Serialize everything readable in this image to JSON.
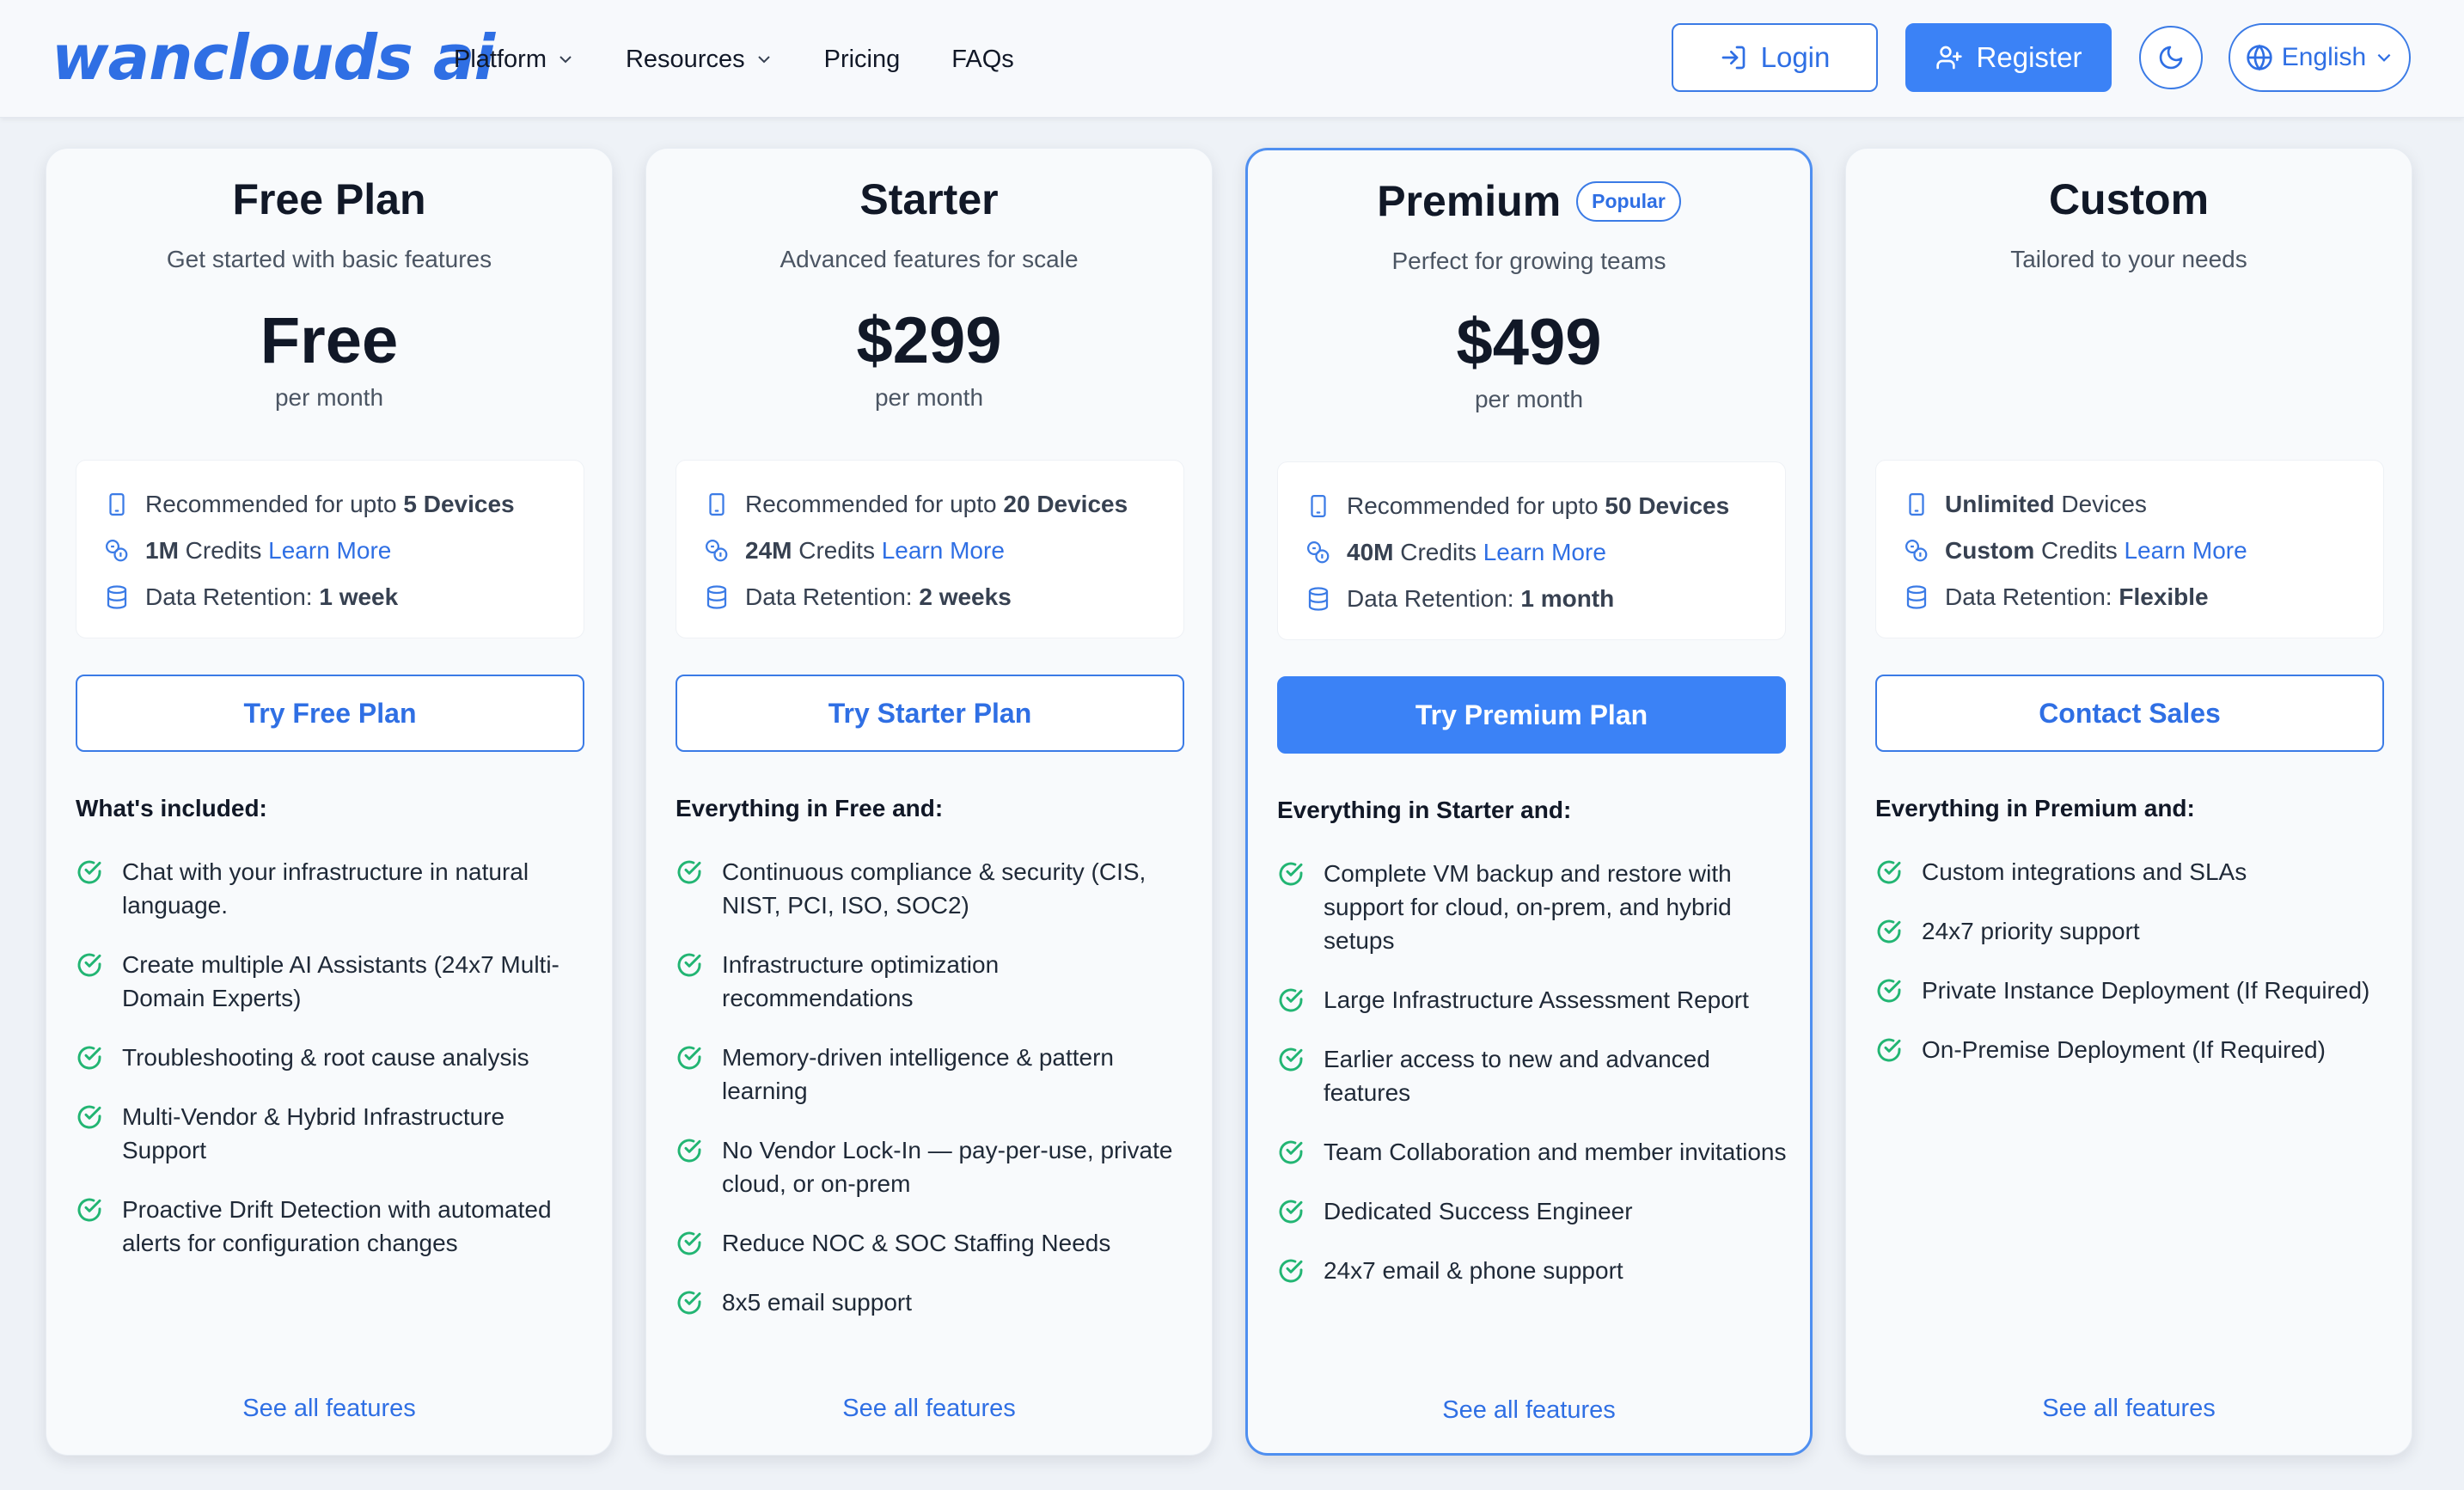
{
  "header": {
    "logo": "wanclouds ai",
    "nav": [
      "Platform",
      "Resources",
      "Pricing",
      "FAQs"
    ],
    "login_label": "Login",
    "register_label": "Register",
    "language_label": "English",
    "accent_color": "#3b82f6"
  },
  "plans": [
    {
      "title": "Free Plan",
      "badge": "",
      "subtitle": "Get started with basic features",
      "price": "Free",
      "period": "per month",
      "devices_prefix": "Recommended for upto ",
      "devices_value": "5 Devices",
      "devices_suffix": "",
      "credits_value": "1M",
      "credits_text": " Credits ",
      "learn_more": "Learn More",
      "retention_label": "Data Retention: ",
      "retention_value": "1 week",
      "cta": "Try Free Plan",
      "included_heading": "What's included:",
      "features": [
        "Chat with your infrastructure in natural language.",
        "Create multiple AI Assistants (24x7 Multi-Domain Experts)",
        "Troubleshooting & root cause analysis",
        "Multi-Vendor & Hybrid Infrastructure Support",
        "Proactive Drift Detection with automated alerts for configuration changes"
      ],
      "see_all": "See all features"
    },
    {
      "title": "Starter",
      "badge": "",
      "subtitle": "Advanced features for scale",
      "price": "$299",
      "period": "per month",
      "devices_prefix": "Recommended for upto ",
      "devices_value": "20 Devices",
      "devices_suffix": "",
      "credits_value": "24M",
      "credits_text": " Credits ",
      "learn_more": "Learn More",
      "retention_label": "Data Retention: ",
      "retention_value": "2 weeks",
      "cta": "Try Starter Plan",
      "included_heading": "Everything in Free and:",
      "features": [
        "Continuous compliance & security (CIS, NIST, PCI, ISO, SOC2)",
        "Infrastructure optimization recommendations",
        "Memory-driven intelligence & pattern learning",
        "No Vendor Lock-In — pay-per-use, private cloud, or on-prem",
        "Reduce NOC & SOC Staffing Needs",
        "8x5 email support"
      ],
      "see_all": "See all features"
    },
    {
      "title": "Premium",
      "badge": "Popular",
      "subtitle": "Perfect for growing teams",
      "price": "$499",
      "period": "per month",
      "devices_prefix": "Recommended for upto ",
      "devices_value": "50 Devices",
      "devices_suffix": "",
      "credits_value": "40M",
      "credits_text": " Credits ",
      "learn_more": "Learn More",
      "retention_label": "Data Retention: ",
      "retention_value": "1 month",
      "cta": "Try Premium Plan",
      "included_heading": "Everything in Starter and:",
      "features": [
        "Complete VM backup and restore with support for cloud, on-prem, and hybrid setups",
        "Large Infrastructure Assessment Report",
        "Earlier access to new and advanced features",
        "Team Collaboration and member invitations",
        "Dedicated Success Engineer",
        "24x7 email & phone support"
      ],
      "see_all": "See all features"
    },
    {
      "title": "Custom",
      "badge": "",
      "subtitle": "Tailored to your needs",
      "price": "",
      "period": "",
      "devices_prefix": "",
      "devices_value": "Unlimited",
      "devices_suffix": " Devices",
      "credits_value": "Custom",
      "credits_text": " Credits ",
      "learn_more": "Learn More",
      "retention_label": "Data Retention: ",
      "retention_value": "Flexible",
      "cta": "Contact Sales",
      "included_heading": "Everything in Premium and:",
      "features": [
        "Custom integrations and SLAs",
        "24x7 priority support",
        "Private Instance Deployment (If Required)",
        "On-Premise Deployment (If Required)"
      ],
      "see_all": "See all features"
    }
  ]
}
